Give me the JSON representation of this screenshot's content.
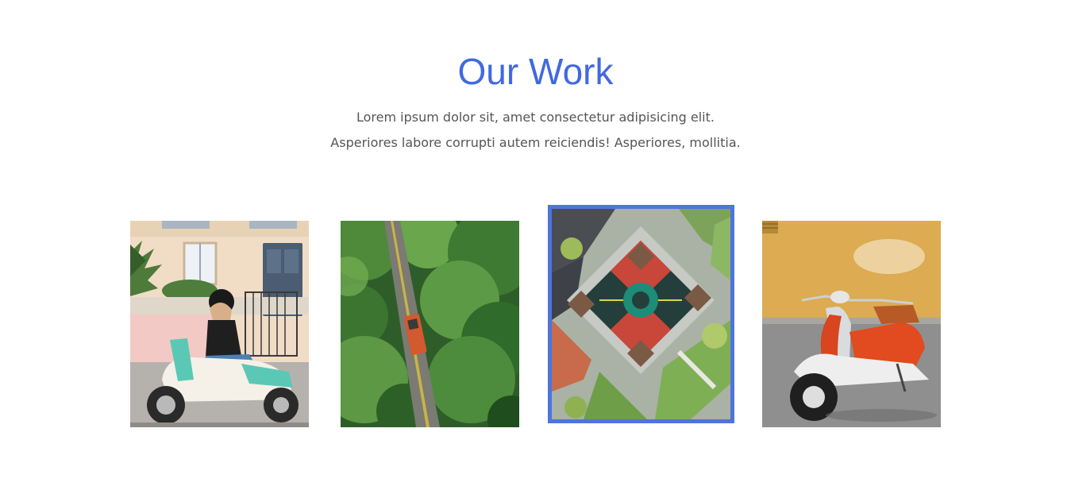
{
  "header": {
    "title": "Our Work",
    "description_lines": [
      "Lorem ipsum dolor sit, amet consectetur adipisicing elit.",
      "Asperiores labore corrupti autem reiciendis! Asperiores, mollitia."
    ]
  },
  "gallery": {
    "items": [
      {
        "subject": "woman-riding-scooter-photo",
        "active": false
      },
      {
        "subject": "aerial-road-trees-photo",
        "active": false
      },
      {
        "subject": "aerial-playground-photo",
        "active": true
      },
      {
        "subject": "vintage-scooter-photo",
        "active": false
      }
    ]
  },
  "colors": {
    "accent": "#4169e1",
    "active_border": "#4f74dc",
    "text": "#555555"
  }
}
